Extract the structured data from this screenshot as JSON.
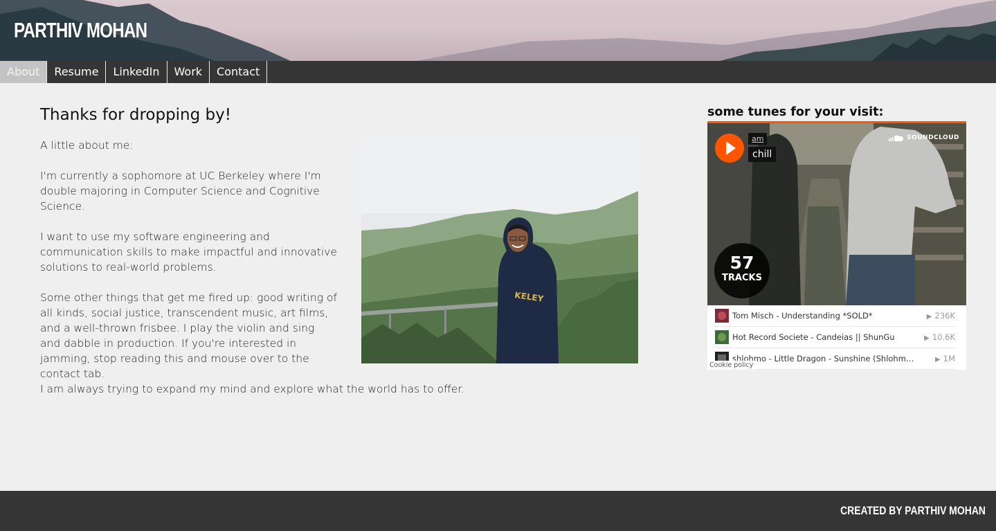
{
  "header": {
    "site_title": "PARTHIV MOHAN"
  },
  "nav": {
    "items": [
      {
        "label": "About",
        "active": true
      },
      {
        "label": "Resume"
      },
      {
        "label": "LinkedIn"
      },
      {
        "label": "Work"
      },
      {
        "label": "Contact"
      }
    ]
  },
  "main": {
    "heading": "Thanks for dropping by!",
    "intro": "A little about me:",
    "p1": "I'm currently a sophomore at UC Berkeley where I'm double majoring in Computer Science and Cognitive Science.",
    "p2": "I want to use my software engineering and communication skills to make impactful and innovative solutions to real-world problems.",
    "p3": "Some other things that get me fired up: good writing of all kinds, social justice, transcendent music, art films, and a well-thrown frisbee. I play the violin and sing and dabble in production. If you're interested in jamming, stop reading this and mouse over to the contact tab.",
    "p4": "I am always trying to expand my mind and explore what the world has to offer."
  },
  "sidebar": {
    "label": "some tunes for your visit:",
    "soundcloud": {
      "user": "am",
      "playlist": "chill",
      "logo_text": "SOUNDCLOUD",
      "track_count": "57",
      "track_count_label": "TRACKS",
      "tracks": [
        {
          "title": "Tom Misch - Understanding *SOLD*",
          "plays": "236K"
        },
        {
          "title": "Hot Record Societe - Candeias || ShunGu",
          "plays": "10.6K"
        },
        {
          "title": "shlohmo - Little Dragon - Sunshine (Shlohmo Remix)",
          "plays": "1M"
        }
      ],
      "cookie_policy": "Cookie policy",
      "accent_color": "#ff5500"
    }
  },
  "footer": {
    "credit": "CREATED BY PARTHIV MOHAN"
  }
}
